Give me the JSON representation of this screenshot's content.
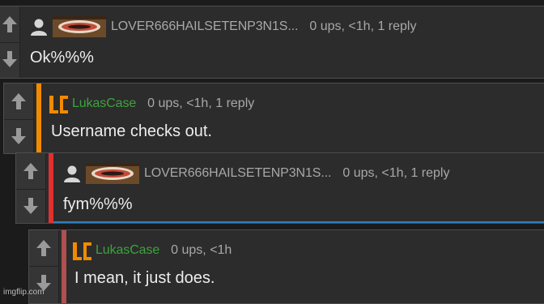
{
  "comments": [
    {
      "username": "LOVER666HAILSETENP3N1S...",
      "meta": "0 ups, <1h, 1 reply",
      "body": "Ok%%%",
      "accent": ""
    },
    {
      "username": "LukasCase",
      "meta": "0 ups, <1h, 1 reply",
      "body": "Username checks out.",
      "accent": "#f28a00"
    },
    {
      "username": "LOVER666HAILSETENP3N1S...",
      "meta": "0 ups, <1h, 1 reply",
      "body": "fym%%%",
      "accent": "#e03030"
    },
    {
      "username": "LukasCase",
      "meta": "0 ups, <1h",
      "body": "I mean, it just does.",
      "accent": "#b05050"
    }
  ],
  "watermark": "imgflip.com",
  "icons": {
    "upvote": "up-arrow-icon",
    "downvote": "down-arrow-icon",
    "user": "user-avatar-icon",
    "logo": "lc-logo-icon"
  }
}
